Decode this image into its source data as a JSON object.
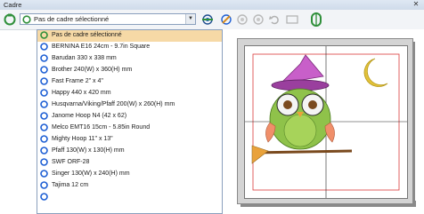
{
  "window": {
    "title": "Cadre",
    "close_glyph": "✕"
  },
  "toolbar": {
    "combo_value": "Pas de cadre sélectionné",
    "combo_arrow": "▼",
    "icons": [
      "hoop-green-icon",
      "settings-hoop-icon",
      "edit-hoop-icon",
      "rotate-left-icon",
      "rotate-right-icon",
      "undo-icon",
      "more-icon",
      "hoop-position-icon"
    ]
  },
  "dropdown": {
    "items": [
      {
        "label": "Pas de cadre sélectionné",
        "ring_color": "#2f8f3a",
        "selected": true
      },
      {
        "label": "BERNINA E16 24cm - 9.7in Square",
        "ring_color": "#1e5fd4",
        "selected": false
      },
      {
        "label": "Barudan 330 x 338 mm",
        "ring_color": "#1e5fd4",
        "selected": false
      },
      {
        "label": "Brother 240(W) x 360(H) mm",
        "ring_color": "#1e5fd4",
        "selected": false
      },
      {
        "label": "Fast Frame 2\" x 4\"",
        "ring_color": "#1e5fd4",
        "selected": false
      },
      {
        "label": "Happy 440 x 420 mm",
        "ring_color": "#1e5fd4",
        "selected": false
      },
      {
        "label": "Husqvarna/Viking/Pfaff 200(W) x 260(H) mm",
        "ring_color": "#1e5fd4",
        "selected": false
      },
      {
        "label": "Janome Hoop N4 (42 x 62)",
        "ring_color": "#1e5fd4",
        "selected": false
      },
      {
        "label": "Melco EMT16 15cm - 5.85in Round",
        "ring_color": "#1e5fd4",
        "selected": false
      },
      {
        "label": "Mighty Hoop 11\" x 13\"",
        "ring_color": "#1e5fd4",
        "selected": false
      },
      {
        "label": "Pfaff 130(W) x 130(H) mm",
        "ring_color": "#1e5fd4",
        "selected": false
      },
      {
        "label": "SWF ORF-28",
        "ring_color": "#1e5fd4",
        "selected": false
      },
      {
        "label": "Singer 130(W) x 240(H) mm",
        "ring_color": "#1e5fd4",
        "selected": false
      },
      {
        "label": "Tajima 12 cm",
        "ring_color": "#1e5fd4",
        "selected": false
      },
      {
        "label": "",
        "ring_color": "#1e5fd4",
        "selected": false
      }
    ]
  },
  "colors": {
    "accent_green": "#2f8f3a",
    "accent_blue": "#1e5fd4",
    "selection": "#f6d9a6"
  }
}
